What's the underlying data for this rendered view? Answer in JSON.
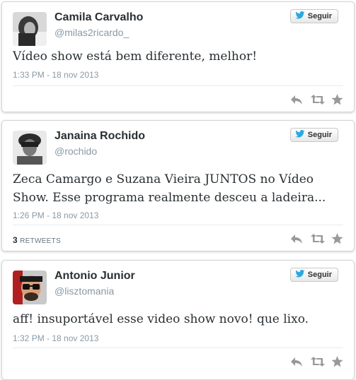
{
  "tweets": [
    {
      "name": "Camila Carvalho",
      "handle": "@milas2ricardo_",
      "follow_label": "Seguir",
      "text": "Vídeo show está bem diferente, melhor!",
      "timestamp": "1:33 PM - 18 nov 2013"
    },
    {
      "name": "Janaina Rochido",
      "handle": "@rochido",
      "follow_label": "Seguir",
      "text": "Zeca Camargo e Suzana Vieira JUNTOS no Vídeo Show. Esse programa realmente desceu a ladeira...",
      "timestamp": "1:26 PM - 18 nov 2013",
      "retweet_count": "3",
      "retweet_label": "RETWEETS"
    },
    {
      "name": "Antonio Junior",
      "handle": "@lisztomania",
      "follow_label": "Seguir",
      "text": "aff! insuportável esse video show novo! que lixo.",
      "timestamp": "1:32 PM - 18 nov 2013"
    }
  ],
  "colors": {
    "bird": "#2aa9e0",
    "action_icons": "#999999",
    "name": "#292f33",
    "meta": "#8899a6"
  },
  "icons": [
    "twitter-bird-icon",
    "reply-icon",
    "retweet-icon",
    "favorite-icon"
  ]
}
